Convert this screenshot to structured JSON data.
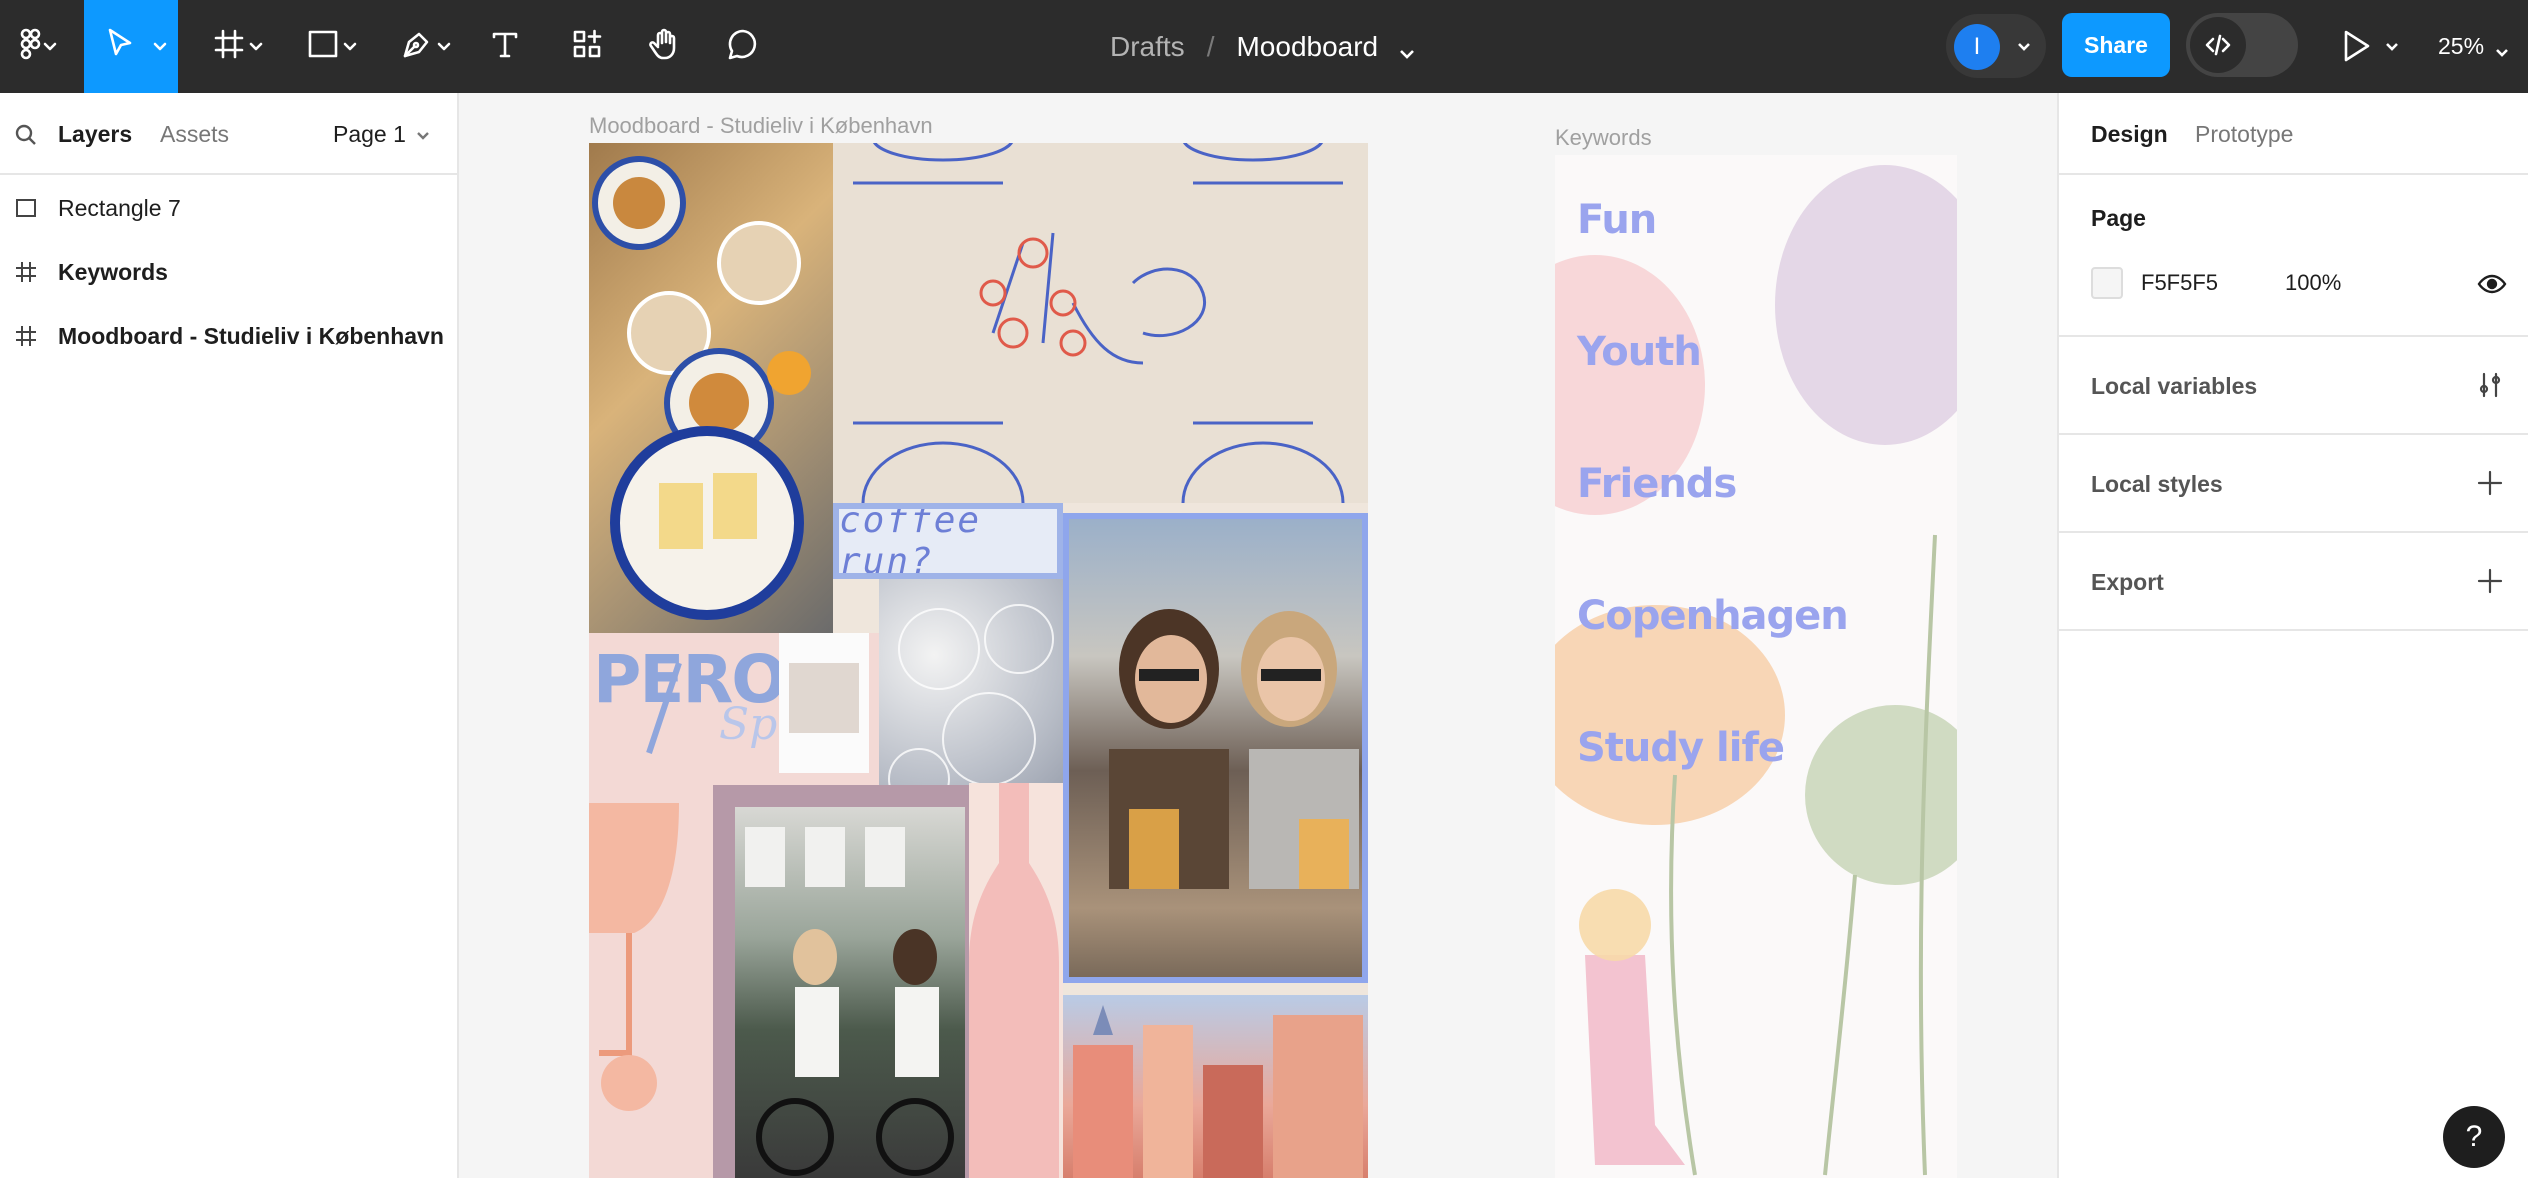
{
  "toolbar": {
    "main_menu_icon": "figma-logo-icon",
    "tools": [
      {
        "name": "move-tool",
        "icon": "cursor-icon",
        "active": true
      },
      {
        "name": "frame-tool",
        "icon": "frame-hash-icon"
      },
      {
        "name": "shape-tool",
        "icon": "rectangle-icon"
      },
      {
        "name": "pen-tool",
        "icon": "pen-icon"
      },
      {
        "name": "text-tool",
        "icon": "text-icon"
      },
      {
        "name": "resources-tool",
        "icon": "components-icon"
      },
      {
        "name": "hand-tool",
        "icon": "hand-icon"
      },
      {
        "name": "comment-tool",
        "icon": "comment-icon"
      }
    ],
    "breadcrumb": {
      "parent": "Drafts",
      "separator": "/",
      "file": "Moodboard"
    },
    "avatar_initial": "I",
    "share_label": "Share",
    "dev_mode_icon": "code-icon",
    "present_icon": "play-icon",
    "zoom": "25%",
    "active_color": "#0d99ff"
  },
  "left_panel": {
    "tabs": {
      "layers": "Layers",
      "assets": "Assets"
    },
    "page_selector": "Page 1",
    "layers": [
      {
        "label": "Rectangle 7",
        "icon": "rectangle-icon",
        "bold": false
      },
      {
        "label": "Keywords",
        "icon": "frame-hash-icon",
        "bold": true
      },
      {
        "label": "Moodboard - Studieliv i København",
        "icon": "frame-hash-icon",
        "bold": true
      }
    ]
  },
  "canvas": {
    "moodboard_frame_label": "Moodboard - Studieliv i København",
    "keywords_frame_label": "Keywords",
    "moodboard_text": {
      "coffee": "coffee run?",
      "peroni": "PERO",
      "spritz": "Spr"
    },
    "keywords": [
      "Fun",
      "Youth",
      "Friends",
      "Copenhagen",
      "Study life"
    ],
    "keyword_color": "#9aa4ee"
  },
  "right_panel": {
    "tabs": {
      "design": "Design",
      "prototype": "Prototype"
    },
    "page_section": {
      "title": "Page",
      "fill_hex": "F5F5F5",
      "opacity": "100%"
    },
    "local_variables": "Local variables",
    "local_styles": "Local styles",
    "export": "Export"
  },
  "help_label": "?"
}
